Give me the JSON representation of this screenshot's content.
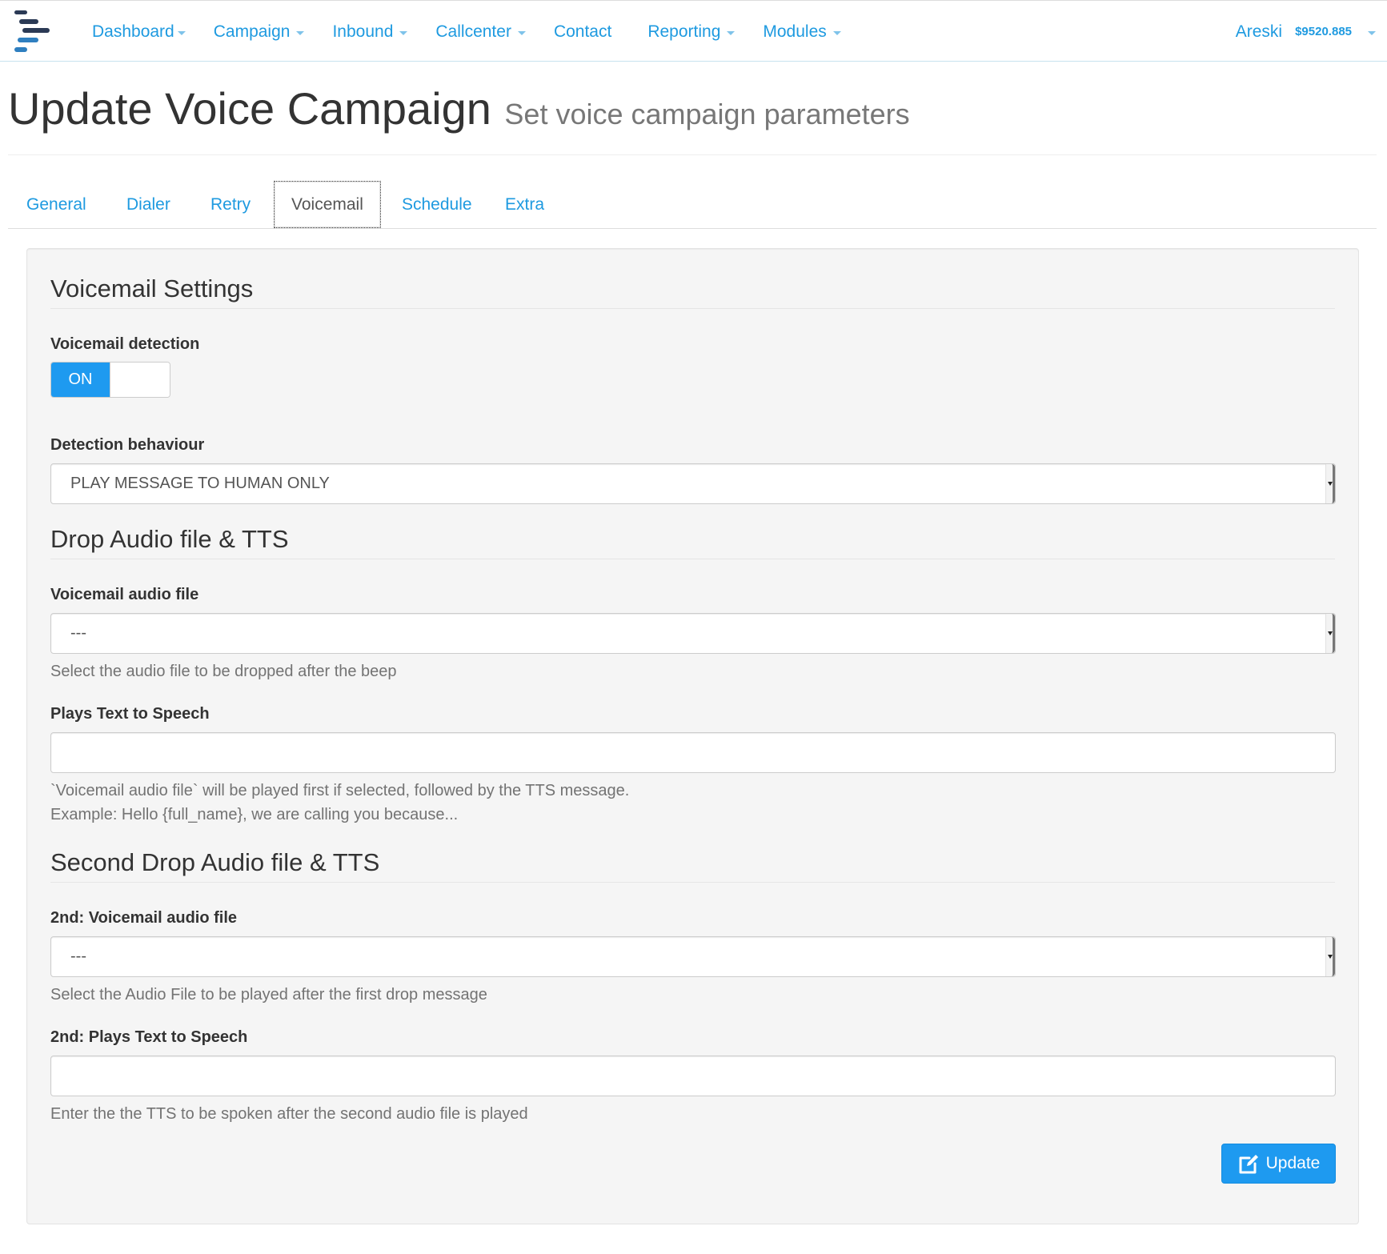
{
  "nav": {
    "items": [
      {
        "label": "Dashboard",
        "caret": true
      },
      {
        "label": "Campaign",
        "caret": true
      },
      {
        "label": "Inbound",
        "caret": true
      },
      {
        "label": "Callcenter",
        "caret": true
      },
      {
        "label": "Contact",
        "caret": false
      },
      {
        "label": "Reporting",
        "caret": true
      },
      {
        "label": "Modules",
        "caret": true
      }
    ],
    "user": "Areski",
    "balance": "$9520.885"
  },
  "header": {
    "title": "Update Voice Campaign",
    "subtitle": "Set voice campaign parameters"
  },
  "tabs": [
    {
      "label": "General",
      "active": false
    },
    {
      "label": "Dialer",
      "active": false
    },
    {
      "label": "Retry",
      "active": false
    },
    {
      "label": "Voicemail",
      "active": true
    },
    {
      "label": "Schedule",
      "active": false
    },
    {
      "label": "Extra",
      "active": false
    }
  ],
  "form": {
    "section1_title": "Voicemail Settings",
    "voicemail_detection_label": "Voicemail detection",
    "voicemail_detection_state": "ON",
    "detection_behaviour_label": "Detection behaviour",
    "detection_behaviour_value": "PLAY MESSAGE TO HUMAN ONLY",
    "section2_title": "Drop Audio file & TTS",
    "vm_audio_label": "Voicemail audio file",
    "vm_audio_value": "---",
    "vm_audio_help": "Select the audio file to be dropped after the beep",
    "tts_label": "Plays Text to Speech",
    "tts_value": "",
    "tts_help_line1": "`Voicemail audio file` will be played first if selected, followed by the TTS message.",
    "tts_help_line2": "Example: Hello {full_name}, we are calling you because...",
    "section3_title": "Second Drop Audio file & TTS",
    "vm2_audio_label": "2nd: Voicemail audio file",
    "vm2_audio_value": "---",
    "vm2_audio_help": "Select the Audio File to be played after the first drop message",
    "tts2_label": "2nd: Plays Text to Speech",
    "tts2_value": "",
    "tts2_help": "Enter the the TTS to be spoken after the second audio file is played",
    "update_button": "Update",
    "update_icon": "edit-icon"
  },
  "colors": {
    "accent": "#1e9af0",
    "link": "#1e9ae0",
    "panel_bg": "#f5f5f5"
  }
}
